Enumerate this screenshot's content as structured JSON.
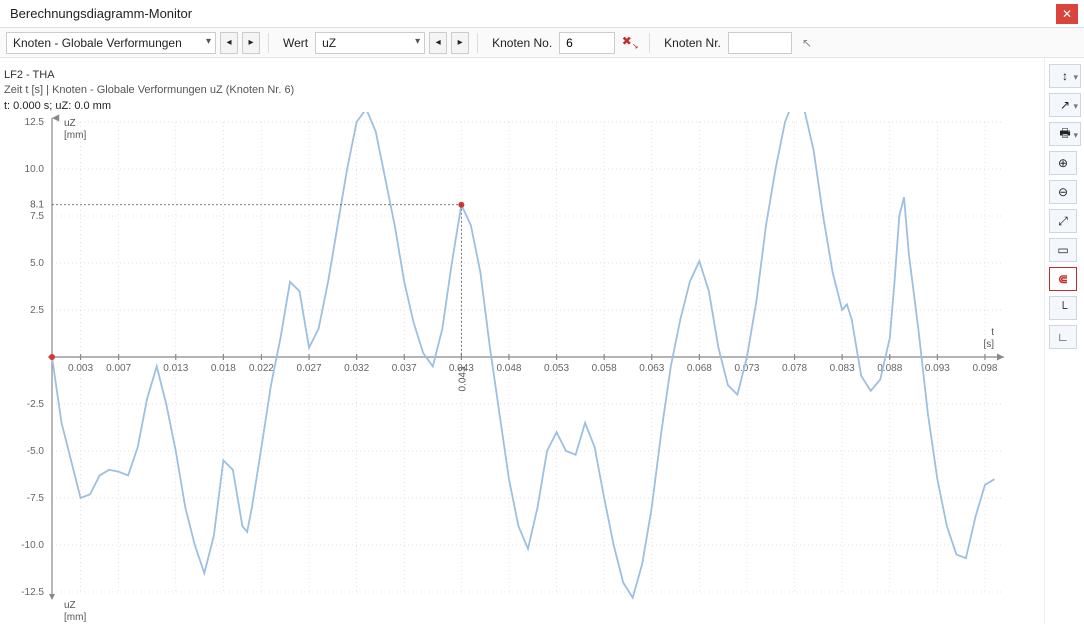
{
  "window": {
    "title": "Berechnungsdiagramm-Monitor"
  },
  "toolbar": {
    "dd1": "Knoten - Globale Verformungen",
    "wert_label": "Wert",
    "dd2": "uZ",
    "knoten_label": "Knoten No.",
    "knoten_value": "6",
    "knoten_nr_label": "Knoten Nr.",
    "knoten_nr_value": ""
  },
  "plot": {
    "title": "LF2 - THA",
    "subtitle": "Zeit t [s] | Knoten - Globale Verformungen uZ (Knoten Nr. 6)",
    "cursor_readout": "t: 0.000 s; uZ: 0.0 mm",
    "yaxis_label_top": "uZ",
    "yaxis_unit": "[mm]",
    "xaxis_label": "t",
    "xaxis_unit": "[s]",
    "yaxis_label_bottom": "uZ",
    "yaxis_unit_bottom": "[mm]",
    "marker_y_label": "8.1",
    "marker_x_label": "0.043"
  },
  "chart_data": {
    "type": "line",
    "title": "LF2 - THA",
    "xlabel": "t [s]",
    "ylabel": "uZ [mm]",
    "xlim": [
      0,
      0.1
    ],
    "ylim": [
      -12.5,
      12.5
    ],
    "x_ticks": [
      0.003,
      0.007,
      0.013,
      0.018,
      0.022,
      0.027,
      0.032,
      0.037,
      0.043,
      0.048,
      0.053,
      0.058,
      0.063,
      0.068,
      0.073,
      0.078,
      0.083,
      0.088,
      0.093,
      0.098
    ],
    "y_ticks": [
      -12.5,
      -10,
      -7.5,
      -5,
      -2.5,
      2.5,
      5,
      7.5,
      10,
      12.5
    ],
    "markers": [
      {
        "x": 0.0,
        "y": 0.0
      },
      {
        "x": 0.043,
        "y": 8.1
      }
    ],
    "series": [
      {
        "name": "uZ Knoten 6",
        "data": [
          [
            0.0,
            0.0
          ],
          [
            0.001,
            -3.5
          ],
          [
            0.002,
            -5.5
          ],
          [
            0.003,
            -7.5
          ],
          [
            0.004,
            -7.3
          ],
          [
            0.005,
            -6.3
          ],
          [
            0.006,
            -6.0
          ],
          [
            0.007,
            -6.1
          ],
          [
            0.008,
            -6.3
          ],
          [
            0.009,
            -4.8
          ],
          [
            0.01,
            -2.2
          ],
          [
            0.011,
            -0.5
          ],
          [
            0.012,
            -2.5
          ],
          [
            0.013,
            -5.0
          ],
          [
            0.014,
            -8.0
          ],
          [
            0.015,
            -10.0
          ],
          [
            0.016,
            -11.5
          ],
          [
            0.017,
            -9.5
          ],
          [
            0.018,
            -5.5
          ],
          [
            0.019,
            -6.0
          ],
          [
            0.02,
            -9.0
          ],
          [
            0.0205,
            -9.3
          ],
          [
            0.021,
            -8.0
          ],
          [
            0.022,
            -4.8
          ],
          [
            0.023,
            -1.5
          ],
          [
            0.024,
            1.0
          ],
          [
            0.025,
            4.0
          ],
          [
            0.026,
            3.5
          ],
          [
            0.027,
            0.5
          ],
          [
            0.028,
            1.5
          ],
          [
            0.029,
            4.0
          ],
          [
            0.03,
            7.0
          ],
          [
            0.031,
            10.0
          ],
          [
            0.032,
            12.5
          ],
          [
            0.033,
            13.2
          ],
          [
            0.034,
            12.0
          ],
          [
            0.035,
            9.5
          ],
          [
            0.036,
            7.0
          ],
          [
            0.037,
            4.0
          ],
          [
            0.038,
            1.8
          ],
          [
            0.039,
            0.2
          ],
          [
            0.04,
            -0.5
          ],
          [
            0.041,
            1.5
          ],
          [
            0.042,
            5.0
          ],
          [
            0.043,
            8.1
          ],
          [
            0.044,
            7.0
          ],
          [
            0.045,
            4.5
          ],
          [
            0.046,
            0.5
          ],
          [
            0.047,
            -3.0
          ],
          [
            0.048,
            -6.5
          ],
          [
            0.049,
            -9.0
          ],
          [
            0.05,
            -10.2
          ],
          [
            0.051,
            -8.0
          ],
          [
            0.052,
            -5.0
          ],
          [
            0.053,
            -4.0
          ],
          [
            0.054,
            -5.0
          ],
          [
            0.055,
            -5.2
          ],
          [
            0.056,
            -3.5
          ],
          [
            0.057,
            -4.8
          ],
          [
            0.058,
            -7.5
          ],
          [
            0.059,
            -10.0
          ],
          [
            0.06,
            -12.0
          ],
          [
            0.061,
            -12.8
          ],
          [
            0.062,
            -11.0
          ],
          [
            0.063,
            -8.0
          ],
          [
            0.064,
            -4.0
          ],
          [
            0.065,
            -0.5
          ],
          [
            0.066,
            2.0
          ],
          [
            0.067,
            4.0
          ],
          [
            0.068,
            5.1
          ],
          [
            0.069,
            3.5
          ],
          [
            0.07,
            0.5
          ],
          [
            0.071,
            -1.5
          ],
          [
            0.072,
            -2.0
          ],
          [
            0.073,
            0.0
          ],
          [
            0.074,
            3.0
          ],
          [
            0.075,
            7.0
          ],
          [
            0.076,
            10.0
          ],
          [
            0.077,
            12.5
          ],
          [
            0.078,
            13.8
          ],
          [
            0.079,
            13.2
          ],
          [
            0.08,
            11.0
          ],
          [
            0.081,
            7.5
          ],
          [
            0.082,
            4.5
          ],
          [
            0.083,
            2.5
          ],
          [
            0.0835,
            2.8
          ],
          [
            0.084,
            2.0
          ],
          [
            0.085,
            -1.0
          ],
          [
            0.086,
            -1.8
          ],
          [
            0.087,
            -1.2
          ],
          [
            0.088,
            1.0
          ],
          [
            0.0885,
            4.0
          ],
          [
            0.089,
            7.5
          ],
          [
            0.0895,
            8.5
          ],
          [
            0.09,
            5.5
          ],
          [
            0.091,
            1.5
          ],
          [
            0.092,
            -3.0
          ],
          [
            0.093,
            -6.5
          ],
          [
            0.094,
            -9.0
          ],
          [
            0.095,
            -10.5
          ],
          [
            0.096,
            -10.7
          ],
          [
            0.097,
            -8.5
          ],
          [
            0.098,
            -6.8
          ],
          [
            0.099,
            -6.5
          ]
        ]
      }
    ]
  }
}
